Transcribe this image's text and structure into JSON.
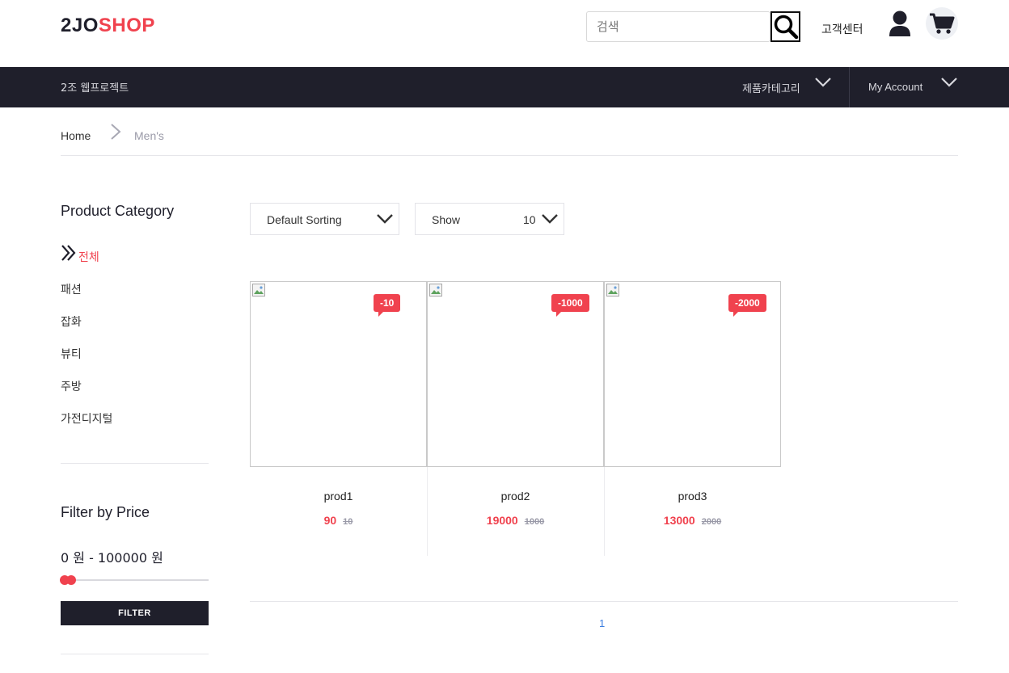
{
  "header": {
    "logo_part1": "2JO",
    "logo_part2": "SHOP",
    "search_placeholder": "검색",
    "search_icon": "search-icon",
    "customer_center": "고객센터",
    "user_icon": "user-icon",
    "cart_icon": "cart-icon"
  },
  "nav": {
    "project": "2조 웹프로젝트",
    "category": "제품카테고리",
    "account": "My Account"
  },
  "breadcrumb": {
    "home": "Home",
    "current": "Men's"
  },
  "sidebar": {
    "title": "Product Category",
    "categories": [
      "전체",
      "패션",
      "잡화",
      "뷰티",
      "주방",
      "가전디지털"
    ],
    "filter_title": "Filter by Price",
    "price_min": "0",
    "price_max": "100000",
    "price_range_text": "0 원 - 100000 원",
    "filter_button": "FILTER"
  },
  "toolbar": {
    "sorting": "Default Sorting",
    "show_label": "Show",
    "show_value": "10"
  },
  "products": [
    {
      "name": "prod1",
      "badge": "-10",
      "price": "90",
      "old_price": "10"
    },
    {
      "name": "prod2",
      "badge": "-1000",
      "price": "19000",
      "old_price": "1000"
    },
    {
      "name": "prod3",
      "badge": "-2000",
      "price": "13000",
      "old_price": "2000"
    }
  ],
  "pagination": {
    "current_page": "1"
  },
  "colors": {
    "accent": "#f0424e",
    "dark": "#1f1f2b",
    "link": "#3d7fe0"
  }
}
